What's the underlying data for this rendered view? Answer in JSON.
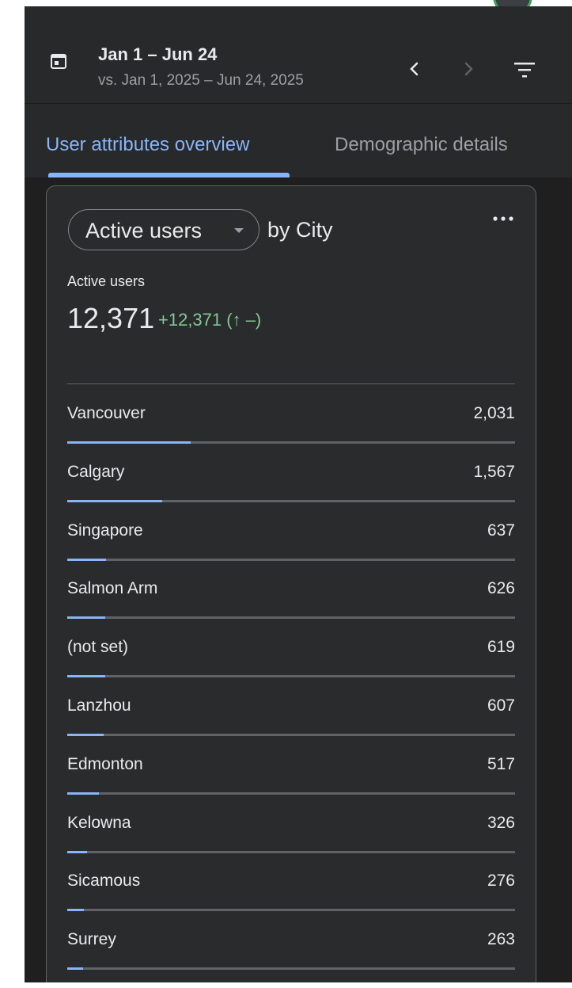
{
  "header": {
    "date_range": "Jan 1 – Jun 24",
    "compare_range": "vs. Jan 1, 2025 – Jun 24, 2025",
    "icons": [
      "calendar-icon",
      "chevron-left-icon",
      "chevron-right-icon",
      "filter-icon"
    ]
  },
  "tabs": [
    {
      "label": "User attributes overview",
      "active": true
    },
    {
      "label": "Demographic details",
      "active": false
    }
  ],
  "card": {
    "metric": "Active users",
    "dimension": "by City",
    "kpi_label": "Active users",
    "kpi_value": "12,371",
    "kpi_delta": "+12,371 (↑ –)",
    "rows": [
      {
        "name": "Vancouver",
        "value": "2,031",
        "share": 0.275
      },
      {
        "name": "Calgary",
        "value": "1,567",
        "share": 0.212
      },
      {
        "name": "Singapore",
        "value": "637",
        "share": 0.086
      },
      {
        "name": "Salmon Arm",
        "value": "626",
        "share": 0.085
      },
      {
        "name": "(not set)",
        "value": "619",
        "share": 0.084
      },
      {
        "name": "Lanzhou",
        "value": "607",
        "share": 0.082
      },
      {
        "name": "Edmonton",
        "value": "517",
        "share": 0.07
      },
      {
        "name": "Kelowna",
        "value": "326",
        "share": 0.044
      },
      {
        "name": "Sicamous",
        "value": "276",
        "share": 0.037
      },
      {
        "name": "Surrey",
        "value": "263",
        "share": 0.036
      }
    ]
  },
  "colors": {
    "accent": "#8ab4f8",
    "positive": "#81c995",
    "background": "#1f1f1f",
    "surface": "#2a2b2c"
  }
}
